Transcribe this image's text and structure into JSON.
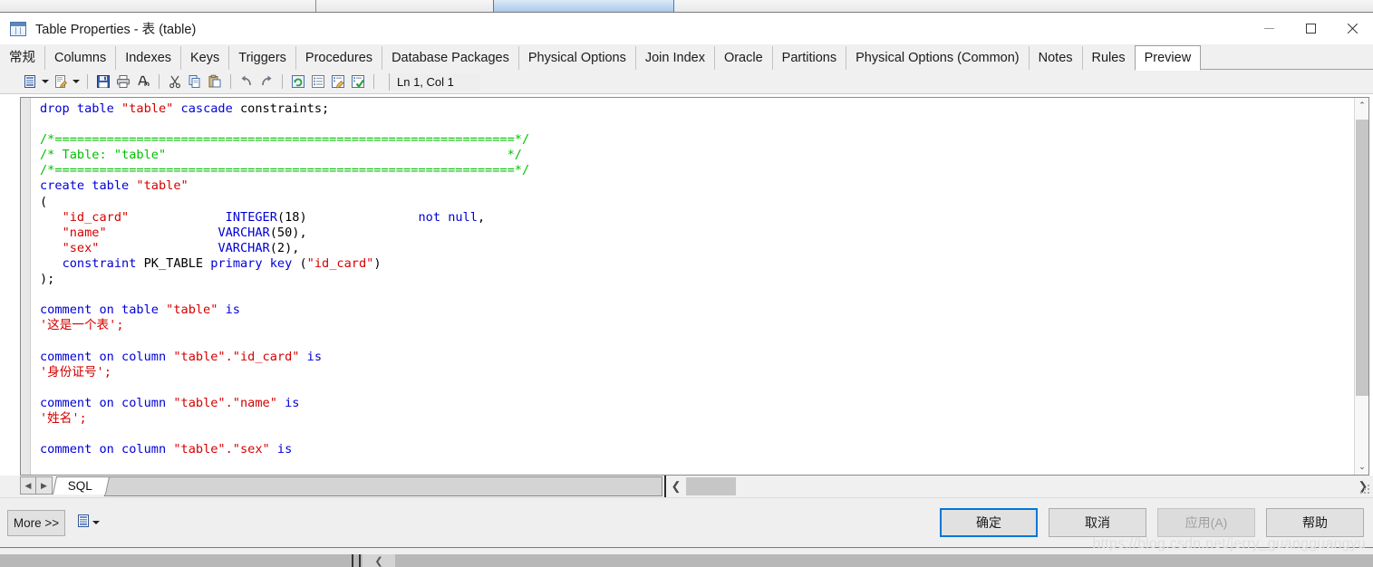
{
  "window": {
    "title": "Table Properties - 表 (table)",
    "icon": "table-icon",
    "controls": {
      "minimize": "minimize-icon",
      "maximize": "maximize-icon",
      "close": "close-icon"
    }
  },
  "tabs": [
    {
      "label": "常规",
      "active": false
    },
    {
      "label": "Columns",
      "active": false
    },
    {
      "label": "Indexes",
      "active": false
    },
    {
      "label": "Keys",
      "active": false
    },
    {
      "label": "Triggers",
      "active": false
    },
    {
      "label": "Procedures",
      "active": false
    },
    {
      "label": "Database Packages",
      "active": false
    },
    {
      "label": "Physical Options",
      "active": false
    },
    {
      "label": "Join Index",
      "active": false
    },
    {
      "label": "Oracle",
      "active": false
    },
    {
      "label": "Partitions",
      "active": false
    },
    {
      "label": "Physical Options (Common)",
      "active": false
    },
    {
      "label": "Notes",
      "active": false
    },
    {
      "label": "Rules",
      "active": false
    },
    {
      "label": "Preview",
      "active": true
    }
  ],
  "toolbar": {
    "items": [
      {
        "name": "generate-script-icon",
        "type": "button"
      },
      {
        "name": "chevron-down-icon",
        "type": "caret"
      },
      {
        "name": "edit-script-icon",
        "type": "button"
      },
      {
        "name": "chevron-down-icon",
        "type": "caret"
      },
      {
        "name": "separator",
        "type": "sep"
      },
      {
        "name": "save-icon",
        "type": "button"
      },
      {
        "name": "print-icon",
        "type": "button"
      },
      {
        "name": "find-icon",
        "type": "button"
      },
      {
        "name": "separator",
        "type": "sep"
      },
      {
        "name": "cut-icon",
        "type": "button"
      },
      {
        "name": "copy-icon",
        "type": "button"
      },
      {
        "name": "paste-icon",
        "type": "button"
      },
      {
        "name": "separator",
        "type": "sep"
      },
      {
        "name": "undo-icon",
        "type": "button"
      },
      {
        "name": "redo-icon",
        "type": "button"
      },
      {
        "name": "separator",
        "type": "sep"
      },
      {
        "name": "refresh-icon",
        "type": "button"
      },
      {
        "name": "properties-icon",
        "type": "button"
      },
      {
        "name": "edit-properties-icon",
        "type": "button"
      },
      {
        "name": "check-properties-icon",
        "type": "button"
      },
      {
        "name": "separator",
        "type": "sep"
      }
    ],
    "cursor_position": "Ln 1, Col 1"
  },
  "editor": {
    "language": "SQL",
    "sheet_tab": "SQL",
    "nav_prev": "◀",
    "nav_next": "▶",
    "code_lines": [
      [
        {
          "t": "drop table ",
          "c": "kw"
        },
        {
          "t": "\"table\"",
          "c": "str"
        },
        {
          "t": " cascade ",
          "c": "kw"
        },
        {
          "t": "constraints;",
          "c": "plain"
        }
      ],
      [],
      [
        {
          "t": "/*==============================================================*/",
          "c": "cmt"
        }
      ],
      [
        {
          "t": "/* Table: \"table\"                                              */",
          "c": "cmt"
        }
      ],
      [
        {
          "t": "/*==============================================================*/",
          "c": "cmt"
        }
      ],
      [
        {
          "t": "create table ",
          "c": "kw"
        },
        {
          "t": "\"table\"",
          "c": "str"
        }
      ],
      [
        {
          "t": "(",
          "c": "plain"
        }
      ],
      [
        {
          "t": "   ",
          "c": "plain"
        },
        {
          "t": "\"id_card\"",
          "c": "str"
        },
        {
          "t": "             ",
          "c": "plain"
        },
        {
          "t": "INTEGER",
          "c": "kw"
        },
        {
          "t": "(18)",
          "c": "plain"
        },
        {
          "t": "               ",
          "c": "plain"
        },
        {
          "t": "not null",
          "c": "kw"
        },
        {
          "t": ",",
          "c": "plain"
        }
      ],
      [
        {
          "t": "   ",
          "c": "plain"
        },
        {
          "t": "\"name\"",
          "c": "str"
        },
        {
          "t": "               ",
          "c": "plain"
        },
        {
          "t": "VARCHAR",
          "c": "kw"
        },
        {
          "t": "(50),",
          "c": "plain"
        }
      ],
      [
        {
          "t": "   ",
          "c": "plain"
        },
        {
          "t": "\"sex\"",
          "c": "str"
        },
        {
          "t": "                ",
          "c": "plain"
        },
        {
          "t": "VARCHAR",
          "c": "kw"
        },
        {
          "t": "(2),",
          "c": "plain"
        }
      ],
      [
        {
          "t": "   ",
          "c": "plain"
        },
        {
          "t": "constraint ",
          "c": "kw"
        },
        {
          "t": "PK_TABLE ",
          "c": "plain"
        },
        {
          "t": "primary key ",
          "c": "kw"
        },
        {
          "t": "(",
          "c": "plain"
        },
        {
          "t": "\"id_card\"",
          "c": "str"
        },
        {
          "t": ")",
          "c": "plain"
        }
      ],
      [
        {
          "t": ");",
          "c": "plain"
        }
      ],
      [],
      [
        {
          "t": "comment on table ",
          "c": "kw"
        },
        {
          "t": "\"table\"",
          "c": "str"
        },
        {
          "t": " is",
          "c": "kw"
        }
      ],
      [
        {
          "t": "'这是一个表';",
          "c": "str"
        }
      ],
      [],
      [
        {
          "t": "comment on column ",
          "c": "kw"
        },
        {
          "t": "\"table\".\"id_card\"",
          "c": "str"
        },
        {
          "t": " is",
          "c": "kw"
        }
      ],
      [
        {
          "t": "'身份证号';",
          "c": "str"
        }
      ],
      [],
      [
        {
          "t": "comment on column ",
          "c": "kw"
        },
        {
          "t": "\"table\".\"name\"",
          "c": "str"
        },
        {
          "t": " is",
          "c": "kw"
        }
      ],
      [
        {
          "t": "'姓名';",
          "c": "str"
        }
      ],
      [],
      [
        {
          "t": "comment on column ",
          "c": "kw"
        },
        {
          "t": "\"table\".\"sex\"",
          "c": "str"
        },
        {
          "t": " is",
          "c": "kw"
        }
      ]
    ]
  },
  "footer": {
    "more_label": "More >>",
    "more_icon": "generate-script-icon",
    "more_caret": "chevron-down-icon",
    "buttons": [
      {
        "label": "确定",
        "state": "default"
      },
      {
        "label": "取消",
        "state": "normal"
      },
      {
        "label": "应用(A)",
        "state": "disabled"
      },
      {
        "label": "帮助",
        "state": "normal"
      }
    ]
  },
  "watermark": "https://blog.csdn.net/jerry_guangguangyu",
  "colors": {
    "keyword": "#0000d8",
    "string": "#d40000",
    "comment": "#00c000",
    "accent": "#0078d7",
    "dialog_bg": "#efefef"
  }
}
